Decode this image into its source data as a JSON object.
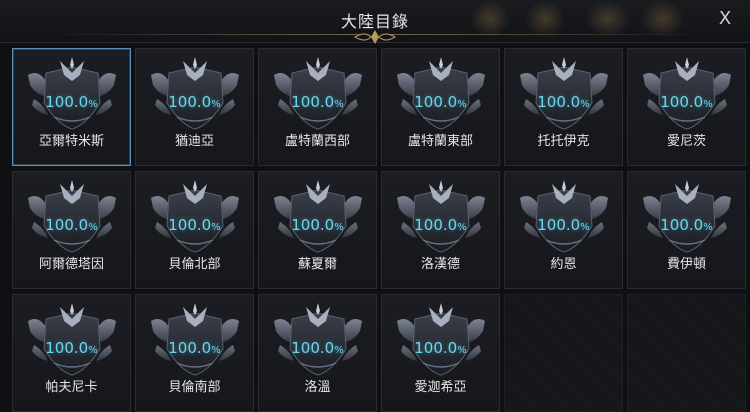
{
  "window": {
    "title": "大陸目錄",
    "close_label": "X"
  },
  "continents": [
    {
      "name": "亞爾特米斯",
      "value": "100.0",
      "unit": "%",
      "selected": true
    },
    {
      "name": "猶迪亞",
      "value": "100.0",
      "unit": "%"
    },
    {
      "name": "盧特蘭西部",
      "value": "100.0",
      "unit": "%"
    },
    {
      "name": "盧特蘭東部",
      "value": "100.0",
      "unit": "%"
    },
    {
      "name": "托托伊克",
      "value": "100.0",
      "unit": "%"
    },
    {
      "name": "愛尼茨",
      "value": "100.0",
      "unit": "%"
    },
    {
      "name": "阿爾德塔因",
      "value": "100.0",
      "unit": "%"
    },
    {
      "name": "貝倫北部",
      "value": "100.0",
      "unit": "%"
    },
    {
      "name": "蘇夏爾",
      "value": "100.0",
      "unit": "%"
    },
    {
      "name": "洛漢德",
      "value": "100.0",
      "unit": "%"
    },
    {
      "name": "約恩",
      "value": "100.0",
      "unit": "%"
    },
    {
      "name": "費伊頓",
      "value": "100.0",
      "unit": "%"
    },
    {
      "name": "帕夫尼卡",
      "value": "100.0",
      "unit": "%"
    },
    {
      "name": "貝倫南部",
      "value": "100.0",
      "unit": "%"
    },
    {
      "name": "洛溫",
      "value": "100.0",
      "unit": "%"
    },
    {
      "name": "愛迦希亞",
      "value": "100.0",
      "unit": "%"
    }
  ],
  "empty_slots": 2,
  "colors": {
    "percent": "#6ed6e8",
    "selected_border": "#5b8fb8",
    "background": "#0e1014"
  },
  "icons": {
    "emblem": "continent-emblem-icon",
    "close": "close-icon"
  }
}
